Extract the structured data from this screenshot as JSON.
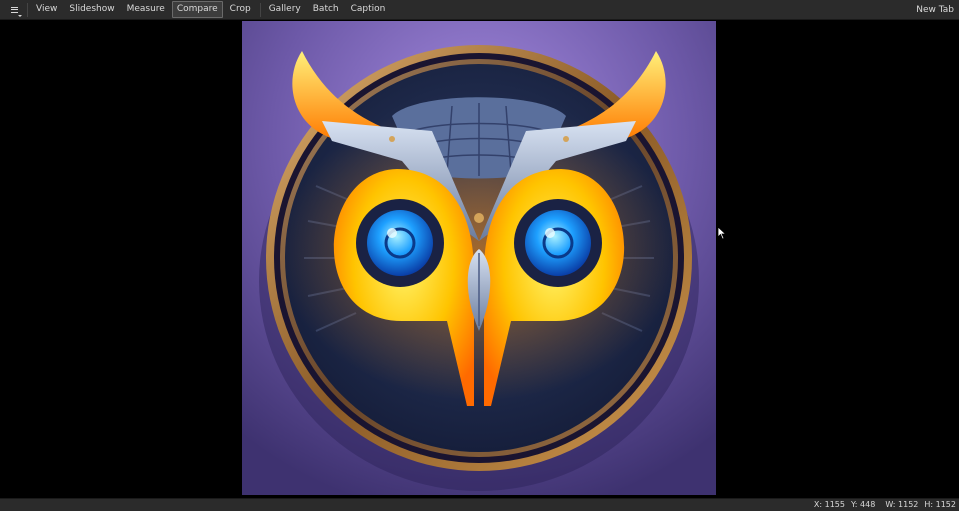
{
  "toolbar": {
    "menu_icon": "hamburger-menu-icon",
    "items": [
      {
        "label": "View",
        "active": false
      },
      {
        "label": "Slideshow",
        "active": false
      },
      {
        "label": "Measure",
        "active": false
      },
      {
        "label": "Compare",
        "active": true
      },
      {
        "label": "Crop",
        "active": false
      },
      {
        "label": "Gallery",
        "active": false
      },
      {
        "label": "Batch",
        "active": false
      },
      {
        "label": "Caption",
        "active": false
      }
    ],
    "new_tab_label": "New Tab"
  },
  "status": {
    "x": "X: 1155",
    "y": "Y: 448",
    "w": "W: 1152",
    "h": "H: 1152"
  },
  "colors": {
    "toolbar_bg": "#2b2b2b",
    "viewer_bg": "#000000",
    "image_bg": "#5a4a86",
    "owl_yellow": "#ffc400",
    "owl_eye": "#1ea0ff",
    "owl_frame": "#b07a3a"
  }
}
